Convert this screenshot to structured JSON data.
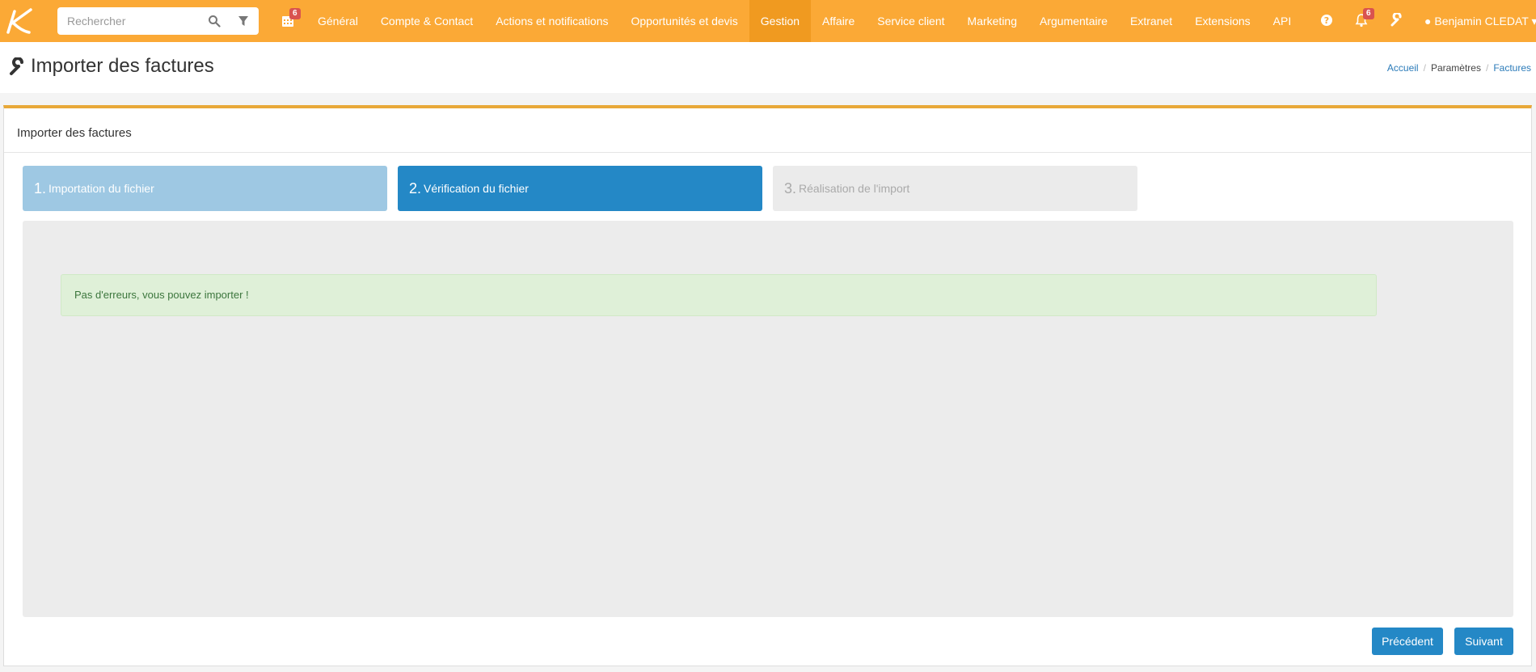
{
  "search": {
    "placeholder": "Rechercher"
  },
  "calendar_badge": "6",
  "nav": {
    "items": [
      {
        "label": "Général"
      },
      {
        "label": "Compte & Contact"
      },
      {
        "label": "Actions et notifications"
      },
      {
        "label": "Opportunités et devis"
      },
      {
        "label": "Gestion",
        "active": true
      },
      {
        "label": "Affaire"
      },
      {
        "label": "Service client"
      },
      {
        "label": "Marketing"
      },
      {
        "label": "Argumentaire"
      },
      {
        "label": "Extranet"
      },
      {
        "label": "Extensions"
      },
      {
        "label": "API"
      }
    ]
  },
  "notifications_badge": "6",
  "user": {
    "name": "Benjamin CLEDAT"
  },
  "page": {
    "title": "Importer des factures",
    "breadcrumb": [
      "Accueil",
      "Paramètres",
      "Factures"
    ]
  },
  "panel": {
    "title": "Importer des factures",
    "steps": [
      {
        "number": "1.",
        "label": "Importation du fichier"
      },
      {
        "number": "2.",
        "label": "Vérification du fichier"
      },
      {
        "number": "3.",
        "label": "Réalisation de l'import"
      }
    ],
    "alert": "Pas d'erreurs, vous pouvez importer !",
    "buttons": {
      "previous": "Précédent",
      "next": "Suivant"
    }
  },
  "colors": {
    "topbar": "#fba936",
    "topbar_active": "#f09a20",
    "primary": "#2488c6",
    "success_bg": "#dff0d8",
    "success_text": "#3c763d"
  }
}
